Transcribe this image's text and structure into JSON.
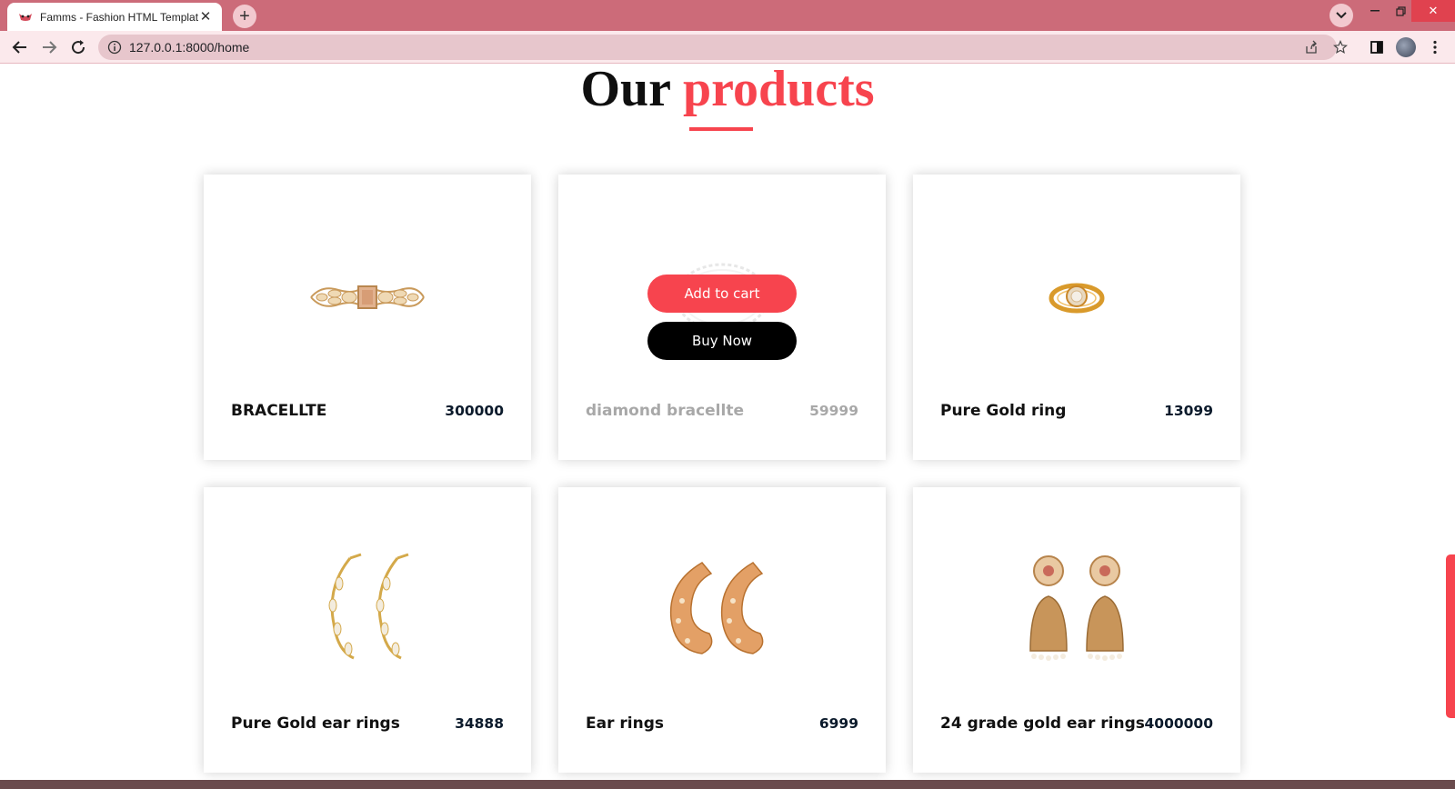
{
  "browser": {
    "tab_title": "Famms - Fashion HTML Template",
    "url": "127.0.0.1:8000/home"
  },
  "section": {
    "heading_prefix": "Our",
    "heading_accent": "products"
  },
  "accent_color": "#f7444e",
  "hover_buttons": {
    "add_to_cart": "Add to cart",
    "buy_now": "Buy Now"
  },
  "products": [
    {
      "name": "BRACELLTE",
      "price": "300000",
      "image": "bracelet-icon"
    },
    {
      "name": "diamond bracellte",
      "price": "59999",
      "image": "diamond-bracelet-icon"
    },
    {
      "name": "Pure Gold ring",
      "price": "13099",
      "image": "ring-icon"
    },
    {
      "name": "Pure Gold ear rings",
      "price": "34888",
      "image": "hoop-earrings-icon"
    },
    {
      "name": "Ear rings",
      "price": "6999",
      "image": "leaf-earrings-icon"
    },
    {
      "name": "24 grade gold ear rings",
      "price": "4000000",
      "image": "jhumka-earrings-icon"
    }
  ]
}
